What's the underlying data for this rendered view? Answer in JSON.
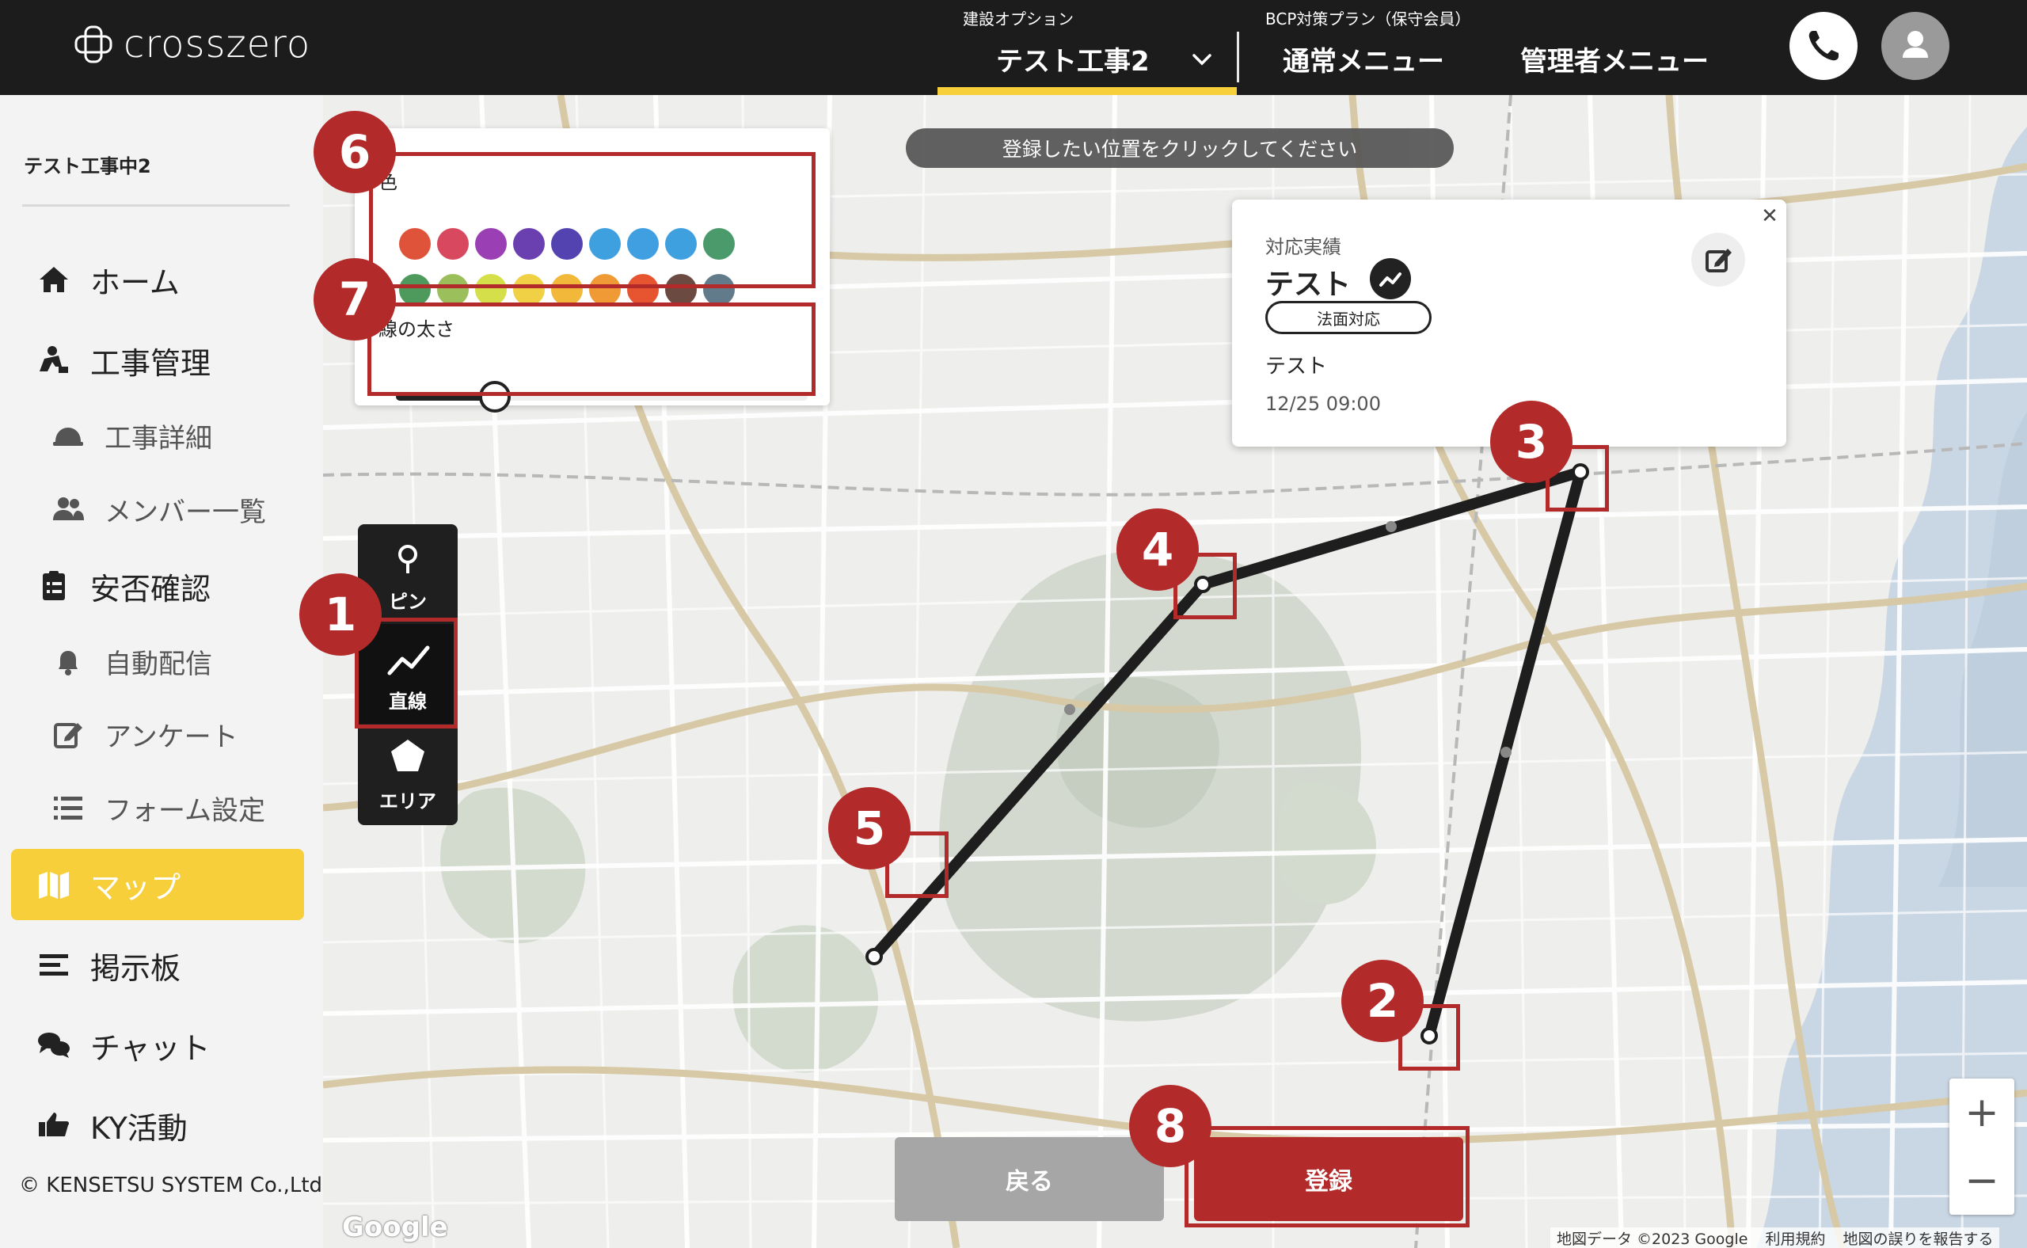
{
  "header": {
    "logo_text": "crosszero",
    "project_option_label": "建設オプション",
    "project_name": "テスト工事2",
    "plan_label": "BCP対策プラン（保守会員）",
    "normal_menu": "通常メニュー",
    "admin_menu": "管理者メニュー",
    "accent_color": "#f7cf3a"
  },
  "sidebar": {
    "project_label": "テスト工事中2",
    "items": [
      {
        "label": "ホーム",
        "icon": "home-icon",
        "level": "main"
      },
      {
        "label": "工事管理",
        "icon": "construction-worker-icon",
        "level": "main"
      },
      {
        "label": "工事詳細",
        "icon": "helmet-icon",
        "level": "sub"
      },
      {
        "label": "メンバー一覧",
        "icon": "users-icon",
        "level": "sub"
      },
      {
        "label": "安否確認",
        "icon": "clipboard-icon",
        "level": "main"
      },
      {
        "label": "自動配信",
        "icon": "bell-icon",
        "level": "sub"
      },
      {
        "label": "アンケート",
        "icon": "edit-icon",
        "level": "sub"
      },
      {
        "label": "フォーム設定",
        "icon": "list-icon",
        "level": "sub"
      },
      {
        "label": "マップ",
        "icon": "map-icon",
        "level": "main",
        "active": true
      },
      {
        "label": "掲示板",
        "icon": "board-icon",
        "level": "main"
      },
      {
        "label": "チャット",
        "icon": "chat-icon",
        "level": "main"
      },
      {
        "label": "KY活動",
        "icon": "thumbs-up-icon",
        "level": "main"
      }
    ],
    "copyright": "© KENSETSU SYSTEM Co.,Ltd."
  },
  "map": {
    "hint": "登録したい位置をクリックしてください",
    "style_panel": {
      "color_label": "色",
      "colors": [
        "#e0533b",
        "#d8485e",
        "#9b3fb5",
        "#6a3fb0",
        "#5343b0",
        "#3fa0e0",
        "#3f9fe0",
        "#3fa0e0",
        "#4b9a6b",
        "#4e9a5d",
        "#9bbf5a",
        "#d5df4a",
        "#f0d045",
        "#f2b83a",
        "#f09a35",
        "#e6552f",
        "#6b4a42",
        "#627b8b"
      ],
      "width_label": "線の太さ",
      "width_value": 0.24
    },
    "tools": [
      {
        "label": "ピン",
        "icon": "pin-icon"
      },
      {
        "label": "直線",
        "icon": "line-chart-icon",
        "active": true
      },
      {
        "label": "エリア",
        "icon": "pentagon-icon"
      }
    ],
    "info_card": {
      "heading": "対応実績",
      "title": "テスト",
      "tag": "法面対応",
      "body": "テスト",
      "time": "12/25 09:00"
    },
    "zoom_in": "+",
    "zoom_out": "−",
    "back_button": "戻る",
    "register_button": "登録",
    "google_logo": "Google",
    "attribution": [
      "地図データ ©2023 Google",
      "利用規約",
      "地図の誤りを報告する"
    ],
    "line_color": "#1e1e1e",
    "annotation_color": "#b32a2a"
  },
  "annotations": [
    "1",
    "2",
    "3",
    "4",
    "5",
    "6",
    "7",
    "8"
  ]
}
